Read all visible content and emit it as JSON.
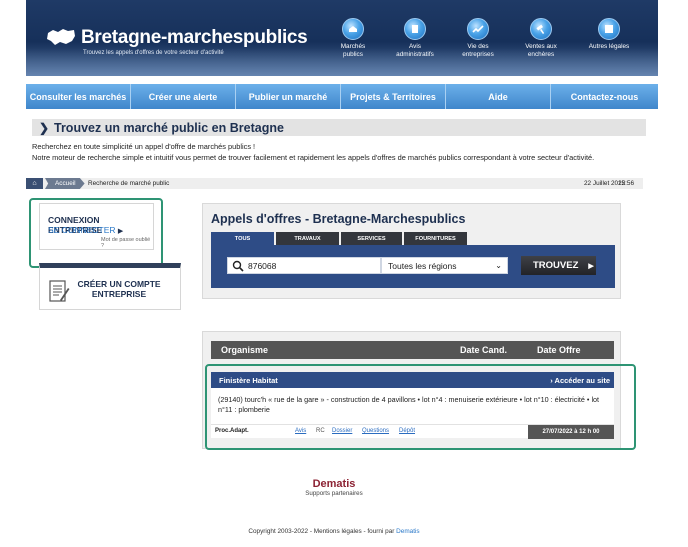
{
  "header": {
    "logo_title": "Bretagne-marchespublics",
    "logo_subtitle": "Trouvez les appels d'offres de votre secteur d'activité",
    "icons": [
      {
        "name": "marches-publics-icon",
        "line1": "Marchés",
        "line2": "publics"
      },
      {
        "name": "avis-administratifs-icon",
        "line1": "Avis",
        "line2": "administratifs"
      },
      {
        "name": "vie-entreprises-icon",
        "line1": "Vie des",
        "line2": "entreprises"
      },
      {
        "name": "ventes-encheres-icon",
        "line1": "Ventes aux",
        "line2": "enchères"
      },
      {
        "name": "autres-legales-icon",
        "line1": "Autres légales",
        "line2": ""
      }
    ]
  },
  "nav": {
    "items": [
      "Consulter les marchés",
      "Créer une alerte",
      "Publier un marché",
      "Projets & Territoires",
      "Aide",
      "Contactez-nous"
    ]
  },
  "page": {
    "title": "Trouvez un marché public en Bretagne",
    "intro_line1": "Recherchez en toute simplicité un appel d'offre de marchés publics !",
    "intro_line2": "Notre moteur de recherche simple et intuitif vous permet de trouver facilement et rapidement les appels d'offres de marchés publics correspondant à votre secteur d'activité."
  },
  "breadcrumb": {
    "home": "Accueil",
    "current": "Recherche de marché public",
    "date": "22 Juillet 2022",
    "time": "15:56"
  },
  "login": {
    "title": "CONNEXION ENTREPRISE",
    "link": "SE CONNECTER",
    "forgot": "Mot de passe oublié ?"
  },
  "create_account": {
    "line1": "CRÉER UN COMPTE",
    "line2": "ENTREPRISE"
  },
  "search": {
    "title": "Appels d'offres - Bretagne-Marchespublics",
    "tabs": [
      "TOUS",
      "TRAVAUX",
      "SERVICES",
      "FOURNITURES"
    ],
    "active_tab": "TOUS",
    "query": "876068",
    "region": "Toutes les régions",
    "button": "TROUVEZ"
  },
  "results": {
    "columns": [
      "Organisme",
      "Date Cand.",
      "Date Offre"
    ],
    "rows": [
      {
        "organisme": "Finistère Habitat",
        "access": "Accéder au site",
        "description": "(29140) tourc'h « rue de la gare » - construction de 4 pavillons • lot n°4 : menuiserie extérieure • lot n°10 : électricité • lot n°11 : plomberie",
        "procedure": "Proc.Adapt.",
        "links": [
          "Avis",
          "RC",
          "Dossier",
          "Questions",
          "Dépôt"
        ],
        "date_offre": "27/07/2022 à 12 h 00"
      }
    ]
  },
  "partner": {
    "name": "Dematis",
    "subtitle": "Supports partenaires"
  },
  "footer": {
    "text": "Copyright 2003-2022 - Mentions légales - fourni par",
    "link": "Dematis"
  }
}
